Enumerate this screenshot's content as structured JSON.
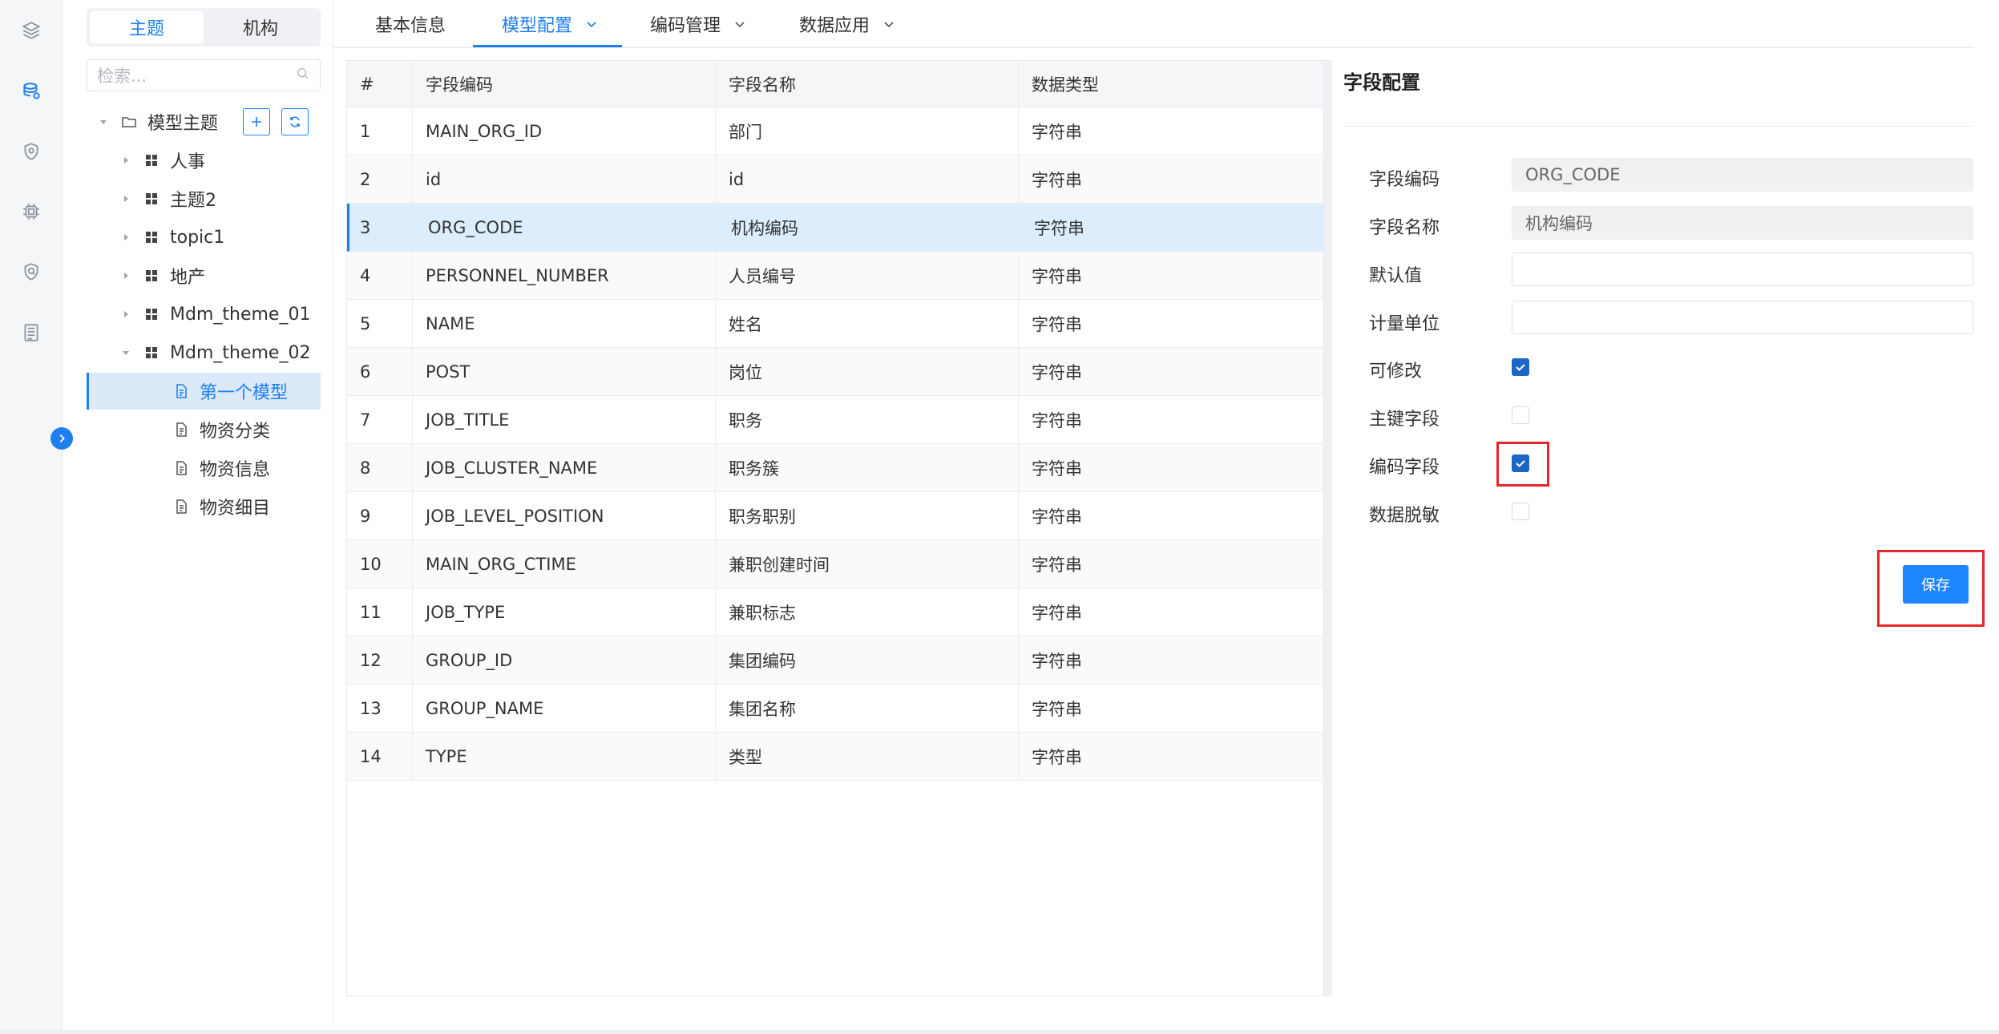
{
  "rail": {
    "icons": [
      "layers-icon",
      "database-icon",
      "shield-pin-icon",
      "chip-icon",
      "shield-check-icon",
      "document-list-icon"
    ]
  },
  "tree_panel": {
    "segments": [
      "主题",
      "机构"
    ],
    "active_segment": "主题",
    "search_placeholder": "检索...",
    "root_label": "模型主题",
    "nodes": [
      {
        "label": "人事"
      },
      {
        "label": "主题2"
      },
      {
        "label": "topic1"
      },
      {
        "label": "地产"
      },
      {
        "label": "Mdm_theme_01"
      },
      {
        "label": "Mdm_theme_02"
      }
    ],
    "children": [
      {
        "label": "第一个模型",
        "selected": true
      },
      {
        "label": "物资分类"
      },
      {
        "label": "物资信息"
      },
      {
        "label": "物资细目"
      }
    ]
  },
  "tabs": [
    {
      "label": "基本信息",
      "dropdown": false
    },
    {
      "label": "模型配置",
      "dropdown": true,
      "active": true
    },
    {
      "label": "编码管理",
      "dropdown": true
    },
    {
      "label": "数据应用",
      "dropdown": true
    }
  ],
  "table": {
    "headers": [
      "#",
      "字段编码",
      "字段名称",
      "数据类型"
    ],
    "selected_row": 3,
    "rows": [
      [
        "1",
        "MAIN_ORG_ID",
        "部门",
        "字符串"
      ],
      [
        "2",
        "id",
        "id",
        "字符串"
      ],
      [
        "3",
        "ORG_CODE",
        "机构编码",
        "字符串"
      ],
      [
        "4",
        "PERSONNEL_NUMBER",
        "人员编号",
        "字符串"
      ],
      [
        "5",
        "NAME",
        "姓名",
        "字符串"
      ],
      [
        "6",
        "POST",
        "岗位",
        "字符串"
      ],
      [
        "7",
        "JOB_TITLE",
        "职务",
        "字符串"
      ],
      [
        "8",
        "JOB_CLUSTER_NAME",
        "职务簇",
        "字符串"
      ],
      [
        "9",
        "JOB_LEVEL_POSITION",
        "职务职别",
        "字符串"
      ],
      [
        "10",
        "MAIN_ORG_CTIME",
        "兼职创建时间",
        "字符串"
      ],
      [
        "11",
        "JOB_TYPE",
        "兼职标志",
        "字符串"
      ],
      [
        "12",
        "GROUP_ID",
        "集团编码",
        "字符串"
      ],
      [
        "13",
        "GROUP_NAME",
        "集团名称",
        "字符串"
      ],
      [
        "14",
        "TYPE",
        "类型",
        "字符串"
      ]
    ]
  },
  "config": {
    "title": "字段配置",
    "fields": {
      "code_label": "字段编码",
      "code_value": "ORG_CODE",
      "name_label": "字段名称",
      "name_value": "机构编码",
      "default_label": "默认值",
      "default_value": "",
      "unit_label": "计量单位",
      "unit_value": ""
    },
    "checks": {
      "editable_label": "可修改",
      "editable": true,
      "primary_key_label": "主键字段",
      "primary_key": false,
      "code_field_label": "编码字段",
      "code_field": true,
      "masking_label": "数据脱敏",
      "masking": false
    },
    "save_label": "保存",
    "accent_color": "#1e7ff0",
    "highlight_color": "#e8262a"
  }
}
